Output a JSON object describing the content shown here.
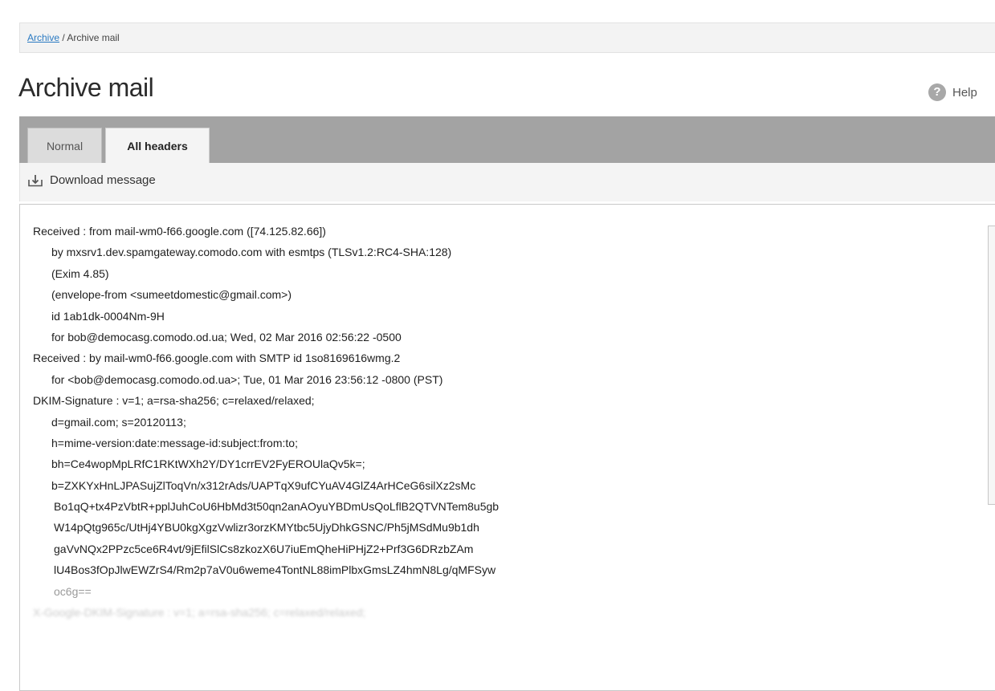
{
  "breadcrumb": {
    "root_link": "Archive",
    "separator": " / ",
    "current": "Archive mail"
  },
  "page_title": "Archive mail",
  "help": {
    "icon": "question-circle-icon",
    "label": "Help"
  },
  "tabs": [
    {
      "label": "Normal",
      "active": false
    },
    {
      "label": "All headers",
      "active": true
    }
  ],
  "toolbar": {
    "download_icon": "download-tray-icon",
    "download_label": "Download message"
  },
  "headers_lines": [
    {
      "text": "Received : from mail-wm0-f66.google.com ([74.125.82.66])",
      "indent": 0
    },
    {
      "text": "by mxsrv1.dev.spamgateway.comodo.com with esmtps (TLSv1.2:RC4-SHA:128)",
      "indent": 1
    },
    {
      "text": "(Exim 4.85)",
      "indent": 1
    },
    {
      "text": "(envelope-from <sumeetdomestic@gmail.com>)",
      "indent": 1
    },
    {
      "text": "id 1ab1dk-0004Nm-9H",
      "indent": 1
    },
    {
      "text": "for bob@democasg.comodo.od.ua; Wed, 02 Mar 2016 02:56:22 -0500",
      "indent": 1
    },
    {
      "text": "Received : by mail-wm0-f66.google.com with SMTP id 1so8169616wmg.2",
      "indent": 0
    },
    {
      "text": "for <bob@democasg.comodo.od.ua>; Tue, 01 Mar 2016 23:56:12 -0800 (PST)",
      "indent": 1
    },
    {
      "text": "DKIM-Signature : v=1; a=rsa-sha256; c=relaxed/relaxed;",
      "indent": 0
    },
    {
      "text": "d=gmail.com; s=20120113;",
      "indent": 1
    },
    {
      "text": "h=mime-version:date:message-id:subject:from:to;",
      "indent": 1
    },
    {
      "text": "bh=Ce4wopMpLRfC1RKtWXh2Y/DY1crrEV2FyEROUlaQv5k=;",
      "indent": 1
    },
    {
      "text": "b=ZXKYxHnLJPASujZlToqVn/x312rAds/UAPTqX9ufCYuAV4GlZ4ArHCeG6silXz2sMc",
      "indent": 1
    },
    {
      "text": "Bo1qQ+tx4PzVbtR+pplJuhCoU6HbMd3t50qn2anAOyuYBDmUsQoLflB2QTVNTem8u5gb",
      "indent": 2
    },
    {
      "text": "W14pQtg965c/UtHj4YBU0kgXgzVwlizr3orzKMYtbc5UjyDhkGSNC/Ph5jMSdMu9b1dh",
      "indent": 2
    },
    {
      "text": "gaVvNQx2PPzc5ce6R4vt/9jEfilSlCs8zkozX6U7iuEmQheHiPHjZ2+Prf3G6DRzbZAm",
      "indent": 2
    },
    {
      "text": "lU4Bos3fOpJlwEWZrS4/Rm2p7aV0u6weme4TontNL88imPlbxGmsLZ4hmN8Lg/qMFSyw",
      "indent": 2
    },
    {
      "text": "oc6g==",
      "indent": 2,
      "style": "faded"
    },
    {
      "text": "X-Google-DKIM-Signature : v=1; a=rsa-sha256; c=relaxed/relaxed;",
      "indent": 0,
      "style": "blurred"
    }
  ]
}
